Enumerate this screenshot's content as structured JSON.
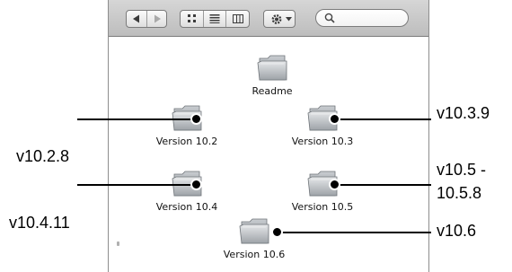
{
  "toolbar": {
    "nav": [
      "back-arrow",
      "forward-arrow"
    ],
    "views": [
      "icon-view",
      "list-view",
      "column-view"
    ],
    "action": "gear-with-dropdown",
    "search": {
      "value": "",
      "placeholder": ""
    }
  },
  "items": [
    {
      "label": "Readme"
    },
    {
      "label": "Version 10.2"
    },
    {
      "label": "Version 10.3"
    },
    {
      "label": "Version 10.4"
    },
    {
      "label": "Version 10.5"
    },
    {
      "label": "Version 10.6"
    }
  ],
  "callouts": {
    "v10_2": "v10.2.8",
    "v10_3": "v10.3.9",
    "v10_4": "v10.4.11",
    "v10_5_line1": "v10.5 -",
    "v10_5_line2": "10.5.8",
    "v10_6": "v10.6"
  },
  "colors": {
    "folder": "#b9bec3",
    "toolbar": "#cdcdcd"
  }
}
